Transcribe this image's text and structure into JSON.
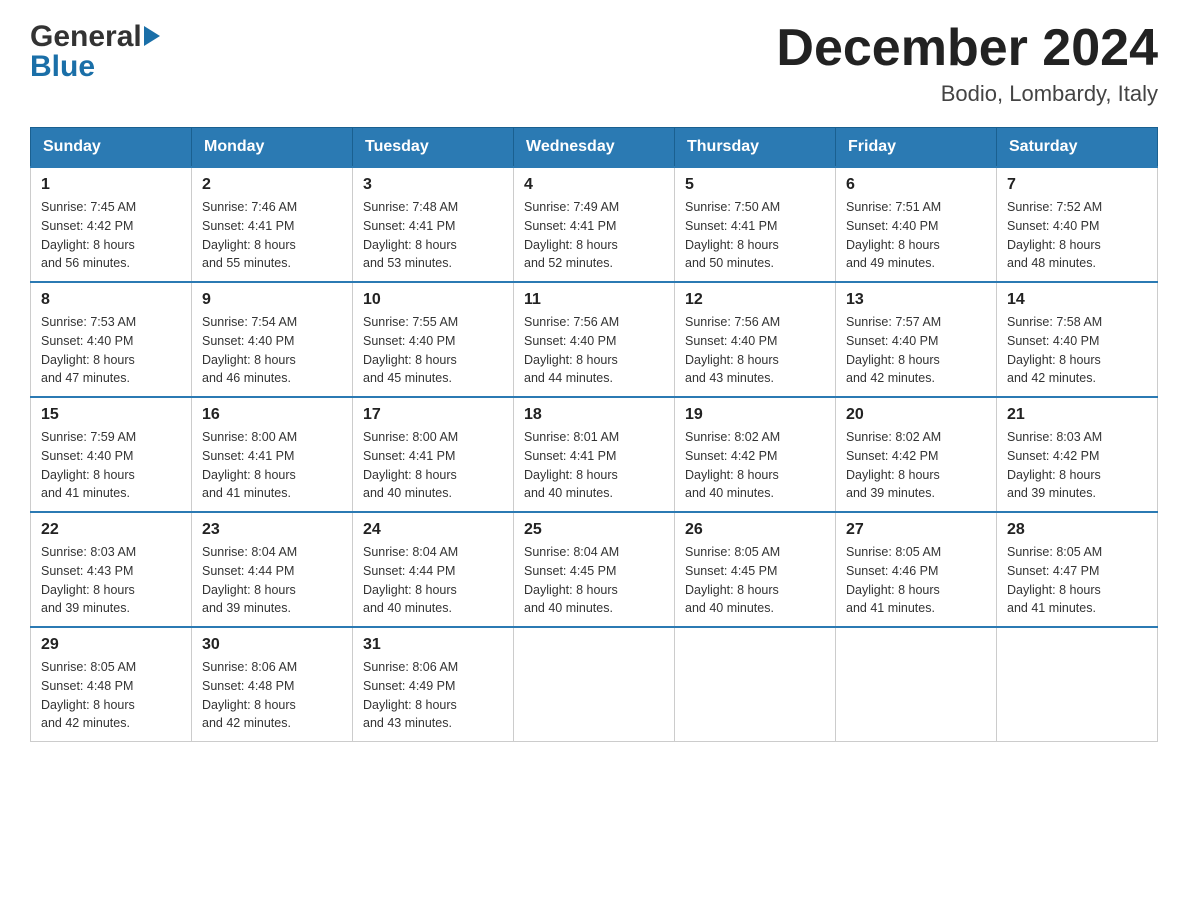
{
  "header": {
    "logo_general": "General",
    "logo_blue": "Blue",
    "month_title": "December 2024",
    "location": "Bodio, Lombardy, Italy"
  },
  "weekdays": [
    "Sunday",
    "Monday",
    "Tuesday",
    "Wednesday",
    "Thursday",
    "Friday",
    "Saturday"
  ],
  "weeks": [
    [
      {
        "day": "1",
        "sunrise": "7:45 AM",
        "sunset": "4:42 PM",
        "daylight": "8 hours and 56 minutes."
      },
      {
        "day": "2",
        "sunrise": "7:46 AM",
        "sunset": "4:41 PM",
        "daylight": "8 hours and 55 minutes."
      },
      {
        "day": "3",
        "sunrise": "7:48 AM",
        "sunset": "4:41 PM",
        "daylight": "8 hours and 53 minutes."
      },
      {
        "day": "4",
        "sunrise": "7:49 AM",
        "sunset": "4:41 PM",
        "daylight": "8 hours and 52 minutes."
      },
      {
        "day": "5",
        "sunrise": "7:50 AM",
        "sunset": "4:41 PM",
        "daylight": "8 hours and 50 minutes."
      },
      {
        "day": "6",
        "sunrise": "7:51 AM",
        "sunset": "4:40 PM",
        "daylight": "8 hours and 49 minutes."
      },
      {
        "day": "7",
        "sunrise": "7:52 AM",
        "sunset": "4:40 PM",
        "daylight": "8 hours and 48 minutes."
      }
    ],
    [
      {
        "day": "8",
        "sunrise": "7:53 AM",
        "sunset": "4:40 PM",
        "daylight": "8 hours and 47 minutes."
      },
      {
        "day": "9",
        "sunrise": "7:54 AM",
        "sunset": "4:40 PM",
        "daylight": "8 hours and 46 minutes."
      },
      {
        "day": "10",
        "sunrise": "7:55 AM",
        "sunset": "4:40 PM",
        "daylight": "8 hours and 45 minutes."
      },
      {
        "day": "11",
        "sunrise": "7:56 AM",
        "sunset": "4:40 PM",
        "daylight": "8 hours and 44 minutes."
      },
      {
        "day": "12",
        "sunrise": "7:56 AM",
        "sunset": "4:40 PM",
        "daylight": "8 hours and 43 minutes."
      },
      {
        "day": "13",
        "sunrise": "7:57 AM",
        "sunset": "4:40 PM",
        "daylight": "8 hours and 42 minutes."
      },
      {
        "day": "14",
        "sunrise": "7:58 AM",
        "sunset": "4:40 PM",
        "daylight": "8 hours and 42 minutes."
      }
    ],
    [
      {
        "day": "15",
        "sunrise": "7:59 AM",
        "sunset": "4:40 PM",
        "daylight": "8 hours and 41 minutes."
      },
      {
        "day": "16",
        "sunrise": "8:00 AM",
        "sunset": "4:41 PM",
        "daylight": "8 hours and 41 minutes."
      },
      {
        "day": "17",
        "sunrise": "8:00 AM",
        "sunset": "4:41 PM",
        "daylight": "8 hours and 40 minutes."
      },
      {
        "day": "18",
        "sunrise": "8:01 AM",
        "sunset": "4:41 PM",
        "daylight": "8 hours and 40 minutes."
      },
      {
        "day": "19",
        "sunrise": "8:02 AM",
        "sunset": "4:42 PM",
        "daylight": "8 hours and 40 minutes."
      },
      {
        "day": "20",
        "sunrise": "8:02 AM",
        "sunset": "4:42 PM",
        "daylight": "8 hours and 39 minutes."
      },
      {
        "day": "21",
        "sunrise": "8:03 AM",
        "sunset": "4:42 PM",
        "daylight": "8 hours and 39 minutes."
      }
    ],
    [
      {
        "day": "22",
        "sunrise": "8:03 AM",
        "sunset": "4:43 PM",
        "daylight": "8 hours and 39 minutes."
      },
      {
        "day": "23",
        "sunrise": "8:04 AM",
        "sunset": "4:44 PM",
        "daylight": "8 hours and 39 minutes."
      },
      {
        "day": "24",
        "sunrise": "8:04 AM",
        "sunset": "4:44 PM",
        "daylight": "8 hours and 40 minutes."
      },
      {
        "day": "25",
        "sunrise": "8:04 AM",
        "sunset": "4:45 PM",
        "daylight": "8 hours and 40 minutes."
      },
      {
        "day": "26",
        "sunrise": "8:05 AM",
        "sunset": "4:45 PM",
        "daylight": "8 hours and 40 minutes."
      },
      {
        "day": "27",
        "sunrise": "8:05 AM",
        "sunset": "4:46 PM",
        "daylight": "8 hours and 41 minutes."
      },
      {
        "day": "28",
        "sunrise": "8:05 AM",
        "sunset": "4:47 PM",
        "daylight": "8 hours and 41 minutes."
      }
    ],
    [
      {
        "day": "29",
        "sunrise": "8:05 AM",
        "sunset": "4:48 PM",
        "daylight": "8 hours and 42 minutes."
      },
      {
        "day": "30",
        "sunrise": "8:06 AM",
        "sunset": "4:48 PM",
        "daylight": "8 hours and 42 minutes."
      },
      {
        "day": "31",
        "sunrise": "8:06 AM",
        "sunset": "4:49 PM",
        "daylight": "8 hours and 43 minutes."
      },
      null,
      null,
      null,
      null
    ]
  ],
  "labels": {
    "sunrise": "Sunrise:",
    "sunset": "Sunset:",
    "daylight": "Daylight:"
  }
}
